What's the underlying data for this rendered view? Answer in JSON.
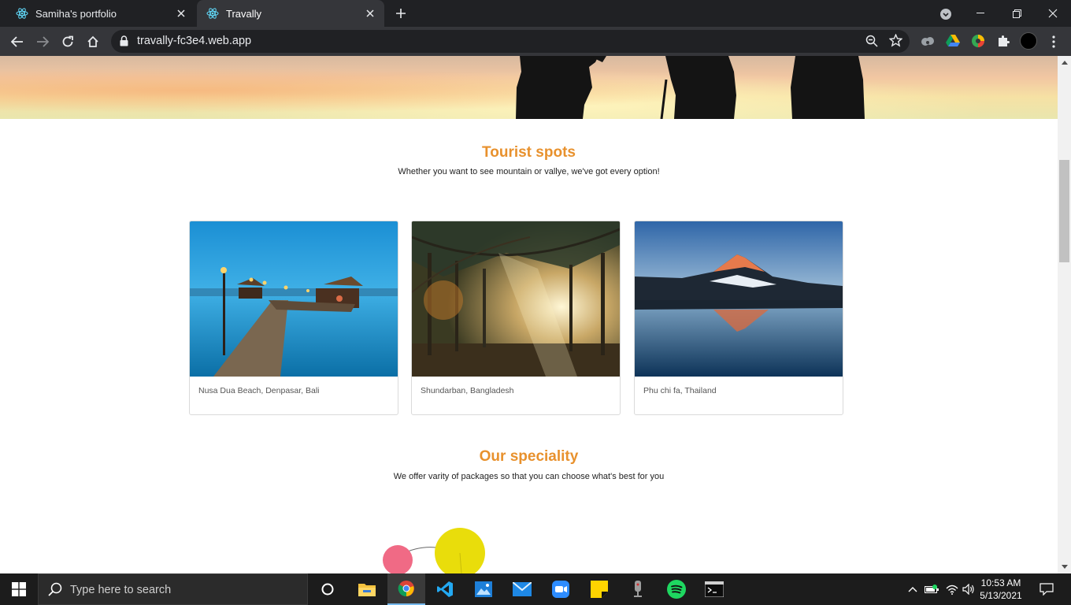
{
  "browser": {
    "tabs": [
      {
        "title": "Samiha's portfolio",
        "active": false
      },
      {
        "title": "Travally",
        "active": true
      }
    ],
    "url": "travally-fc3e4.web.app"
  },
  "page": {
    "tourist_section": {
      "title": "Tourist spots",
      "subtitle": "Whether you want to see mountain or vallye, we've got every option!",
      "cards": [
        {
          "caption": "Nusa Dua Beach, Denpasar, Bali"
        },
        {
          "caption": "Shundarban, Bangladesh"
        },
        {
          "caption": "Phu chi fa, Thailand"
        }
      ]
    },
    "speciality_section": {
      "title": "Our speciality",
      "subtitle": "We offer varity of packages so that you can choose what's best for you"
    }
  },
  "taskbar": {
    "search_placeholder": "Type here to search",
    "time": "10:53 AM",
    "date": "5/13/2021"
  },
  "colors": {
    "accent_orange": "#e8912d",
    "chrome_dark": "#202124",
    "chrome_toolbar": "#35363a",
    "taskbar": "#1c1c1c"
  }
}
